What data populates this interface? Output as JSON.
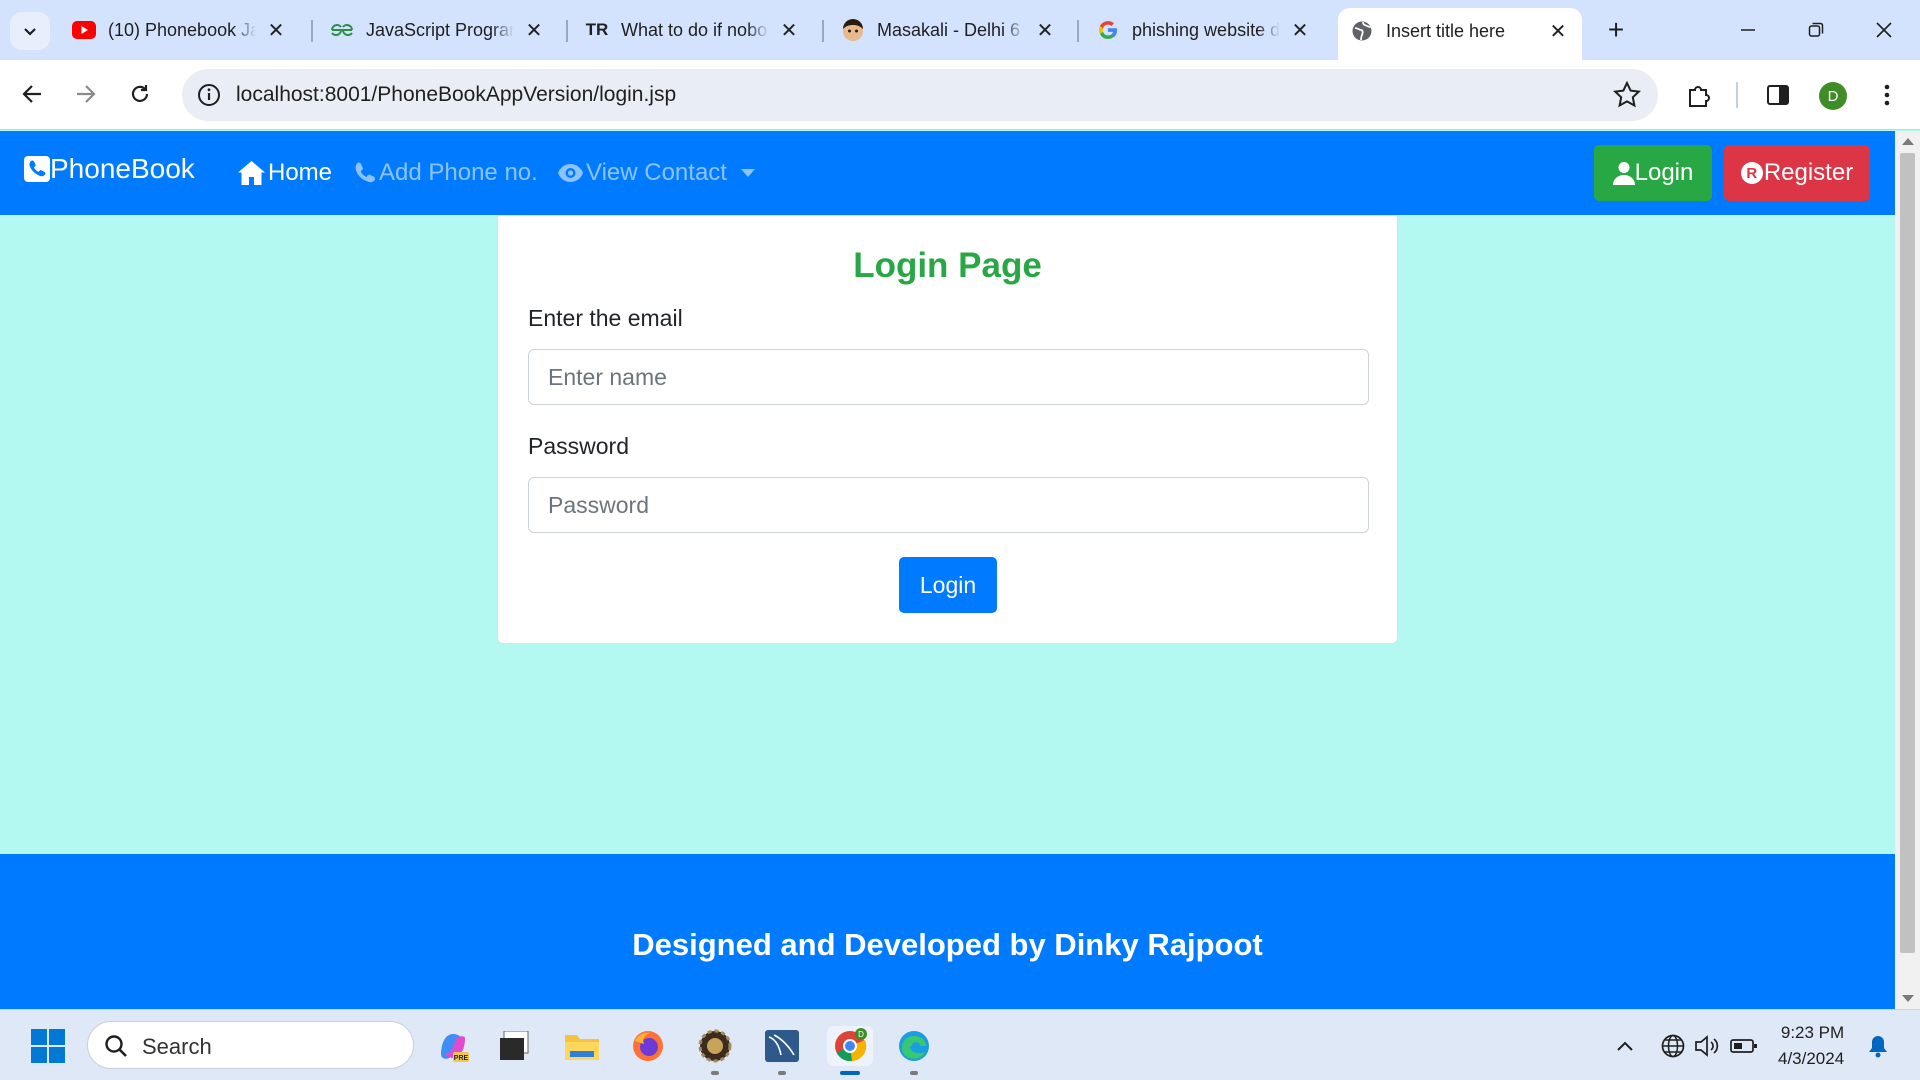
{
  "browser": {
    "tabs": [
      {
        "title": "(10) Phonebook Ja",
        "icon": "youtube-icon"
      },
      {
        "title": "JavaScript Progran",
        "icon": "geeksforgeeks-icon"
      },
      {
        "title": "What to do if nobo",
        "icon": "tr-icon",
        "icon_text": "TR"
      },
      {
        "title": "Masakali - Delhi 6",
        "icon": "face-icon"
      },
      {
        "title": "phishing website d",
        "icon": "google-icon"
      },
      {
        "title": "Insert title here",
        "icon": "globe-icon",
        "active": true
      }
    ],
    "new_tab_label": "+",
    "url": "localhost:8001/PhoneBookAppVersion/login.jsp",
    "profile_initial": "D"
  },
  "navbar": {
    "brand": "PhoneBook",
    "links": [
      {
        "label": "Home",
        "icon": "home-icon"
      },
      {
        "label": "Add Phone no.",
        "icon": "phone-icon"
      },
      {
        "label": "View Contact",
        "icon": "eye-icon"
      }
    ],
    "login_label": "Login",
    "register_label": "Register",
    "register_icon_text": "R"
  },
  "login_card": {
    "title": "Login Page",
    "email_label": "Enter the email",
    "email_placeholder": "Enter name",
    "password_label": "Password",
    "password_placeholder": "Password",
    "submit_label": "Login"
  },
  "footer": {
    "text": "Designed and Developed by Dinky Rajpoot"
  },
  "taskbar": {
    "search_placeholder": "Search",
    "time": "9:23 PM",
    "date": "4/3/2024"
  },
  "colors": {
    "primary": "#007bff",
    "success": "#28a745",
    "danger": "#dc3545",
    "page_bg": "#b3f9f2"
  }
}
